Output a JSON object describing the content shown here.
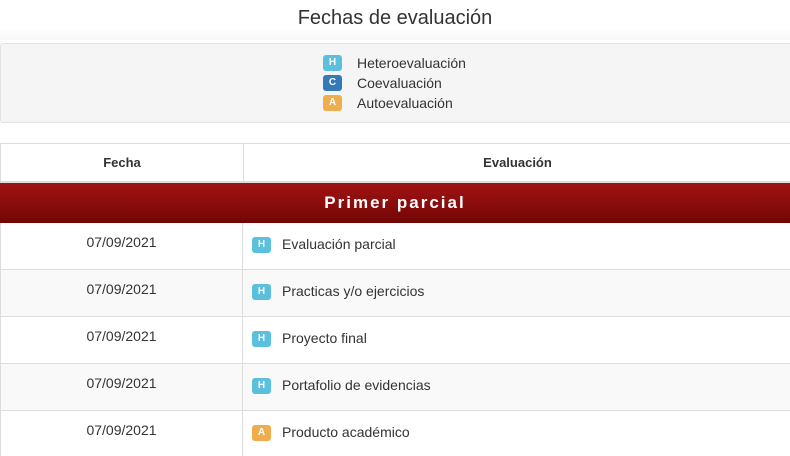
{
  "title": "Fechas de evaluación",
  "legend": [
    {
      "badge": "H",
      "type": "h",
      "label": "Heteroevaluación"
    },
    {
      "badge": "C",
      "type": "c",
      "label": "Coevaluación"
    },
    {
      "badge": "A",
      "type": "a",
      "label": "Autoevaluación"
    }
  ],
  "table": {
    "headers": {
      "fecha": "Fecha",
      "evaluacion": "Evaluación"
    },
    "section": "Primer parcial",
    "rows": [
      {
        "fecha": "07/09/2021",
        "badge": "H",
        "type": "h",
        "evaluacion": "Evaluación parcial"
      },
      {
        "fecha": "07/09/2021",
        "badge": "H",
        "type": "h",
        "evaluacion": "Practicas y/o ejercicios"
      },
      {
        "fecha": "07/09/2021",
        "badge": "H",
        "type": "h",
        "evaluacion": "Proyecto final"
      },
      {
        "fecha": "07/09/2021",
        "badge": "H",
        "type": "h",
        "evaluacion": "Portafolio de evidencias"
      },
      {
        "fecha": "07/09/2021",
        "badge": "A",
        "type": "a",
        "evaluacion": "Producto académico"
      }
    ]
  },
  "colors": {
    "hetero": "#5bc0de",
    "coeval": "#337ab7",
    "autoeval": "#f0ad4e",
    "section_header": "#8a0c0c"
  }
}
